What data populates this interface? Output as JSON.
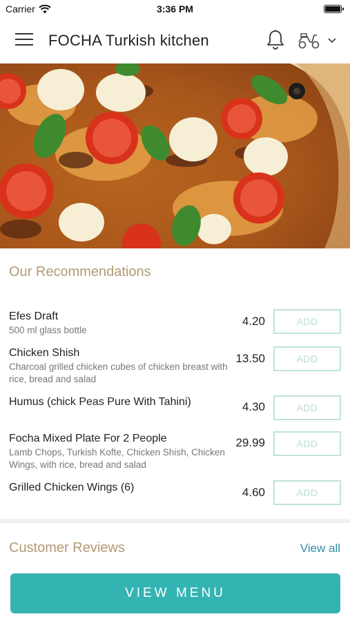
{
  "status_bar": {
    "carrier": "Carrier",
    "time": "3:36 PM"
  },
  "nav": {
    "title": "FOCHA Turkish kitchen"
  },
  "recommendations": {
    "title": "Our Recommendations",
    "add_label": "ADD",
    "items": [
      {
        "name": "Efes Draft",
        "desc": "500 ml glass bottle",
        "price": "4.20"
      },
      {
        "name": "Chicken Shish",
        "desc": "Charcoal grilled chicken cubes of chicken breast with rice, bread and salad",
        "price": "13.50"
      },
      {
        "name": "Humus (chick Peas Pure With Tahini)",
        "desc": "",
        "price": "4.30"
      },
      {
        "name": "Focha Mixed Plate For 2 People",
        "desc": "Lamb Chops, Turkish Kofte, Chicken Shish, Chicken Wings, with rice, bread and salad",
        "price": "29.99"
      },
      {
        "name": "Grilled Chicken Wings (6)",
        "desc": "",
        "price": "4.60"
      }
    ]
  },
  "reviews": {
    "title": "Customer Reviews",
    "view_all": "View all"
  },
  "cta": {
    "label": "VIEW MENU"
  },
  "colors": {
    "accent": "#34b3b3",
    "section_title": "#b39a74",
    "link": "#2f8fa7",
    "add_border": "#bfe3dd"
  }
}
